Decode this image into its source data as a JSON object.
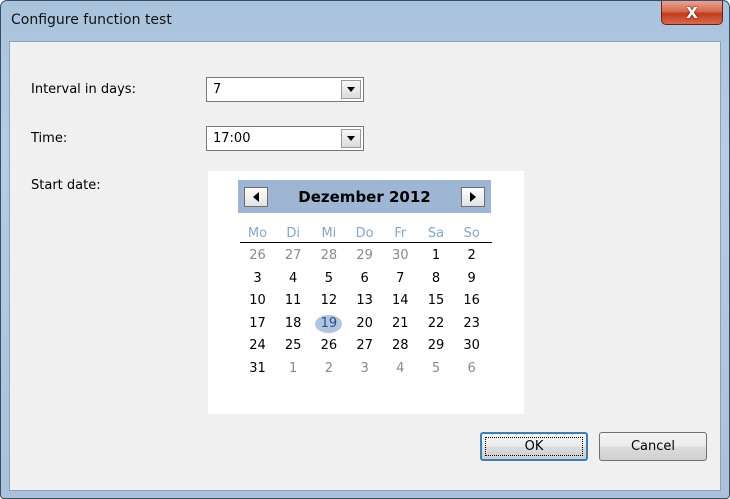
{
  "window": {
    "title": "Configure function test",
    "close_label": "X"
  },
  "form": {
    "interval_label": "Interval in days:",
    "interval_value": "7",
    "time_label": "Time:",
    "time_value": "17:00",
    "start_date_label": "Start date:"
  },
  "calendar": {
    "month_title": "Dezember 2012",
    "weekdays": [
      "Mo",
      "Di",
      "Mi",
      "Do",
      "Fr",
      "Sa",
      "So"
    ],
    "weeks": [
      [
        "26",
        "27",
        "28",
        "29",
        "30",
        "1",
        "2"
      ],
      [
        "3",
        "4",
        "5",
        "6",
        "7",
        "8",
        "9"
      ],
      [
        "10",
        "11",
        "12",
        "13",
        "14",
        "15",
        "16"
      ],
      [
        "17",
        "18",
        "19",
        "20",
        "21",
        "22",
        "23"
      ],
      [
        "24",
        "25",
        "26",
        "27",
        "28",
        "29",
        "30"
      ],
      [
        "31",
        "1",
        "2",
        "3",
        "4",
        "5",
        "6"
      ]
    ],
    "other_month_days": [
      [
        0,
        0
      ],
      [
        0,
        1
      ],
      [
        0,
        2
      ],
      [
        0,
        3
      ],
      [
        0,
        4
      ],
      [
        5,
        1
      ],
      [
        5,
        2
      ],
      [
        5,
        3
      ],
      [
        5,
        4
      ],
      [
        5,
        5
      ],
      [
        5,
        6
      ]
    ],
    "selected_day": [
      3,
      2
    ]
  },
  "buttons": {
    "ok_label": "OK",
    "cancel_label": "Cancel"
  },
  "colors": {
    "calendar_header": "#9eb6d4",
    "weekday_text": "#8aa5c6",
    "selected_day_highlight": "#b2c5e0",
    "close_button": "#c23c1e"
  }
}
